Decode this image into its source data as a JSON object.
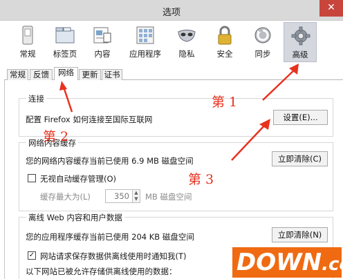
{
  "window": {
    "title": "选项",
    "close_glyph": "✕"
  },
  "toolbar": {
    "panes": [
      {
        "label": "常规",
        "icon": "switch-icon"
      },
      {
        "label": "标签页",
        "icon": "folder-tabs-icon"
      },
      {
        "label": "内容",
        "icon": "content-page-icon"
      },
      {
        "label": "应用程序",
        "icon": "applications-icon"
      },
      {
        "label": "隐私",
        "icon": "mask-icon"
      },
      {
        "label": "安全",
        "icon": "padlock-icon"
      },
      {
        "label": "同步",
        "icon": "sync-icon"
      },
      {
        "label": "高级",
        "icon": "gear-icon",
        "selected": true
      }
    ]
  },
  "tabs": [
    {
      "label": "常规"
    },
    {
      "label": "反馈"
    },
    {
      "label": "网络",
      "active": true
    },
    {
      "label": "更新"
    },
    {
      "label": "证书"
    }
  ],
  "connection": {
    "legend": "连接",
    "description": "配置 Firefox 如何连接至国际互联网",
    "settings_button": "设置(E)..."
  },
  "cache": {
    "legend": "网络内容缓存",
    "usage_text": "您的网络内容缓存当前已使用 6.9 MB 磁盘空间",
    "clear_button": "立即清除(C)",
    "override_label": "无视自动缓存管理(O)",
    "override_checked": false,
    "limit_label": "缓存最大为(L)",
    "limit_value": "350",
    "limit_unit": "MB 磁盘空间"
  },
  "offline": {
    "legend": "离线 Web 内容和用户数据",
    "usage_text": "您的应用程序缓存当前已使用 204 KB 磁盘空间",
    "clear_button": "立即清除(N)",
    "notify_label": "网站请求保存数据供离线使用时通知我(T)",
    "notify_checked": true,
    "allowed_text": "以下网站已被允许存储供离线使用的数据："
  },
  "annotations": {
    "step1": "第 1",
    "step2": "第 2",
    "step3": "第 3",
    "color": "#e8321f"
  },
  "watermark": {
    "main": "DOWN",
    "suffix": ".cc",
    "color": "#f06a12"
  }
}
